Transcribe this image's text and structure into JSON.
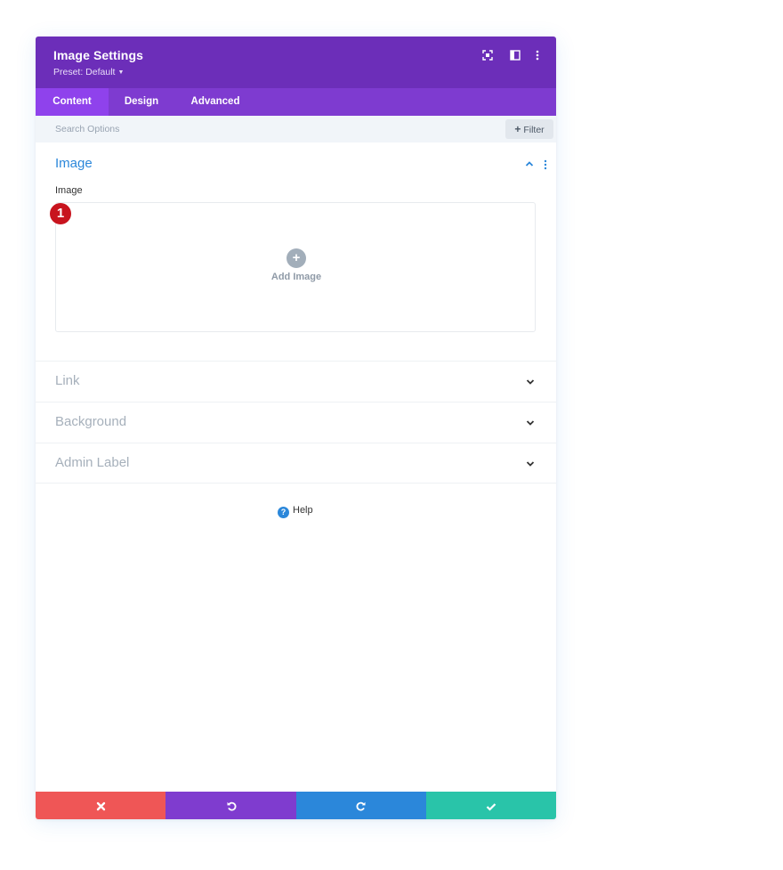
{
  "header": {
    "title": "Image Settings",
    "preset": "Preset: Default",
    "icons": [
      "fullscreen-icon",
      "split-view-icon",
      "more-options-icon"
    ]
  },
  "tabs": [
    {
      "label": "Content",
      "active": true
    },
    {
      "label": "Design",
      "active": false
    },
    {
      "label": "Advanced",
      "active": false
    }
  ],
  "search": {
    "placeholder": "Search Options",
    "filter_label": "Filter"
  },
  "image_section": {
    "title": "Image",
    "field_label": "Image",
    "upload_label": "Add Image",
    "marker": "1"
  },
  "sections": [
    {
      "label": "Link"
    },
    {
      "label": "Background"
    },
    {
      "label": "Admin Label"
    }
  ],
  "help": {
    "label": "Help"
  },
  "footer": {
    "buttons": [
      {
        "name": "cancel",
        "color": "#ef5656"
      },
      {
        "name": "undo",
        "color": "#7f3ccf"
      },
      {
        "name": "redo",
        "color": "#2b87da"
      },
      {
        "name": "save",
        "color": "#29c4a9"
      }
    ]
  },
  "colors": {
    "header": "#6c2eb9",
    "tabs": "#7e3bd0",
    "active_tab": "#8f42ec",
    "accent": "#2b87da"
  }
}
